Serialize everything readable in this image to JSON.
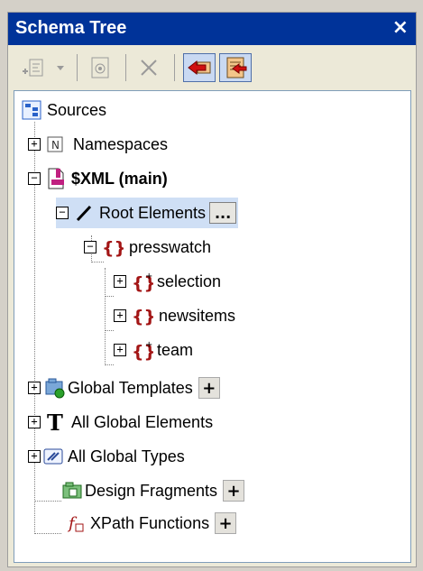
{
  "window": {
    "title": "Schema Tree",
    "close_glyph": "×"
  },
  "toolbar": {
    "buttons": [
      {
        "icon": "add-element-icon"
      },
      {
        "icon": "dropdown-icon"
      },
      {
        "icon": "insert-fragment-icon"
      },
      {
        "icon": "delete-icon"
      },
      {
        "icon": "back-icon"
      },
      {
        "icon": "forward-icon"
      }
    ]
  },
  "tree": {
    "sources": "Sources",
    "namespaces": "Namespaces",
    "xml_main": "$XML (main)",
    "root_elements": "Root Elements",
    "presswatch": "presswatch",
    "selection": "selection",
    "newsitems": "newsitems",
    "team": "team",
    "global_templates": "Global Templates",
    "all_global_elements": "All Global Elements",
    "all_global_types": "All Global Types",
    "design_fragments": "Design Fragments",
    "xpath_functions": "XPath Functions",
    "plus": "+",
    "minus": "−",
    "ellipsis": "..."
  },
  "colors": {
    "title_bg": "#003399",
    "selection_bg": "#cfdff5",
    "element_red": "#a31515"
  }
}
